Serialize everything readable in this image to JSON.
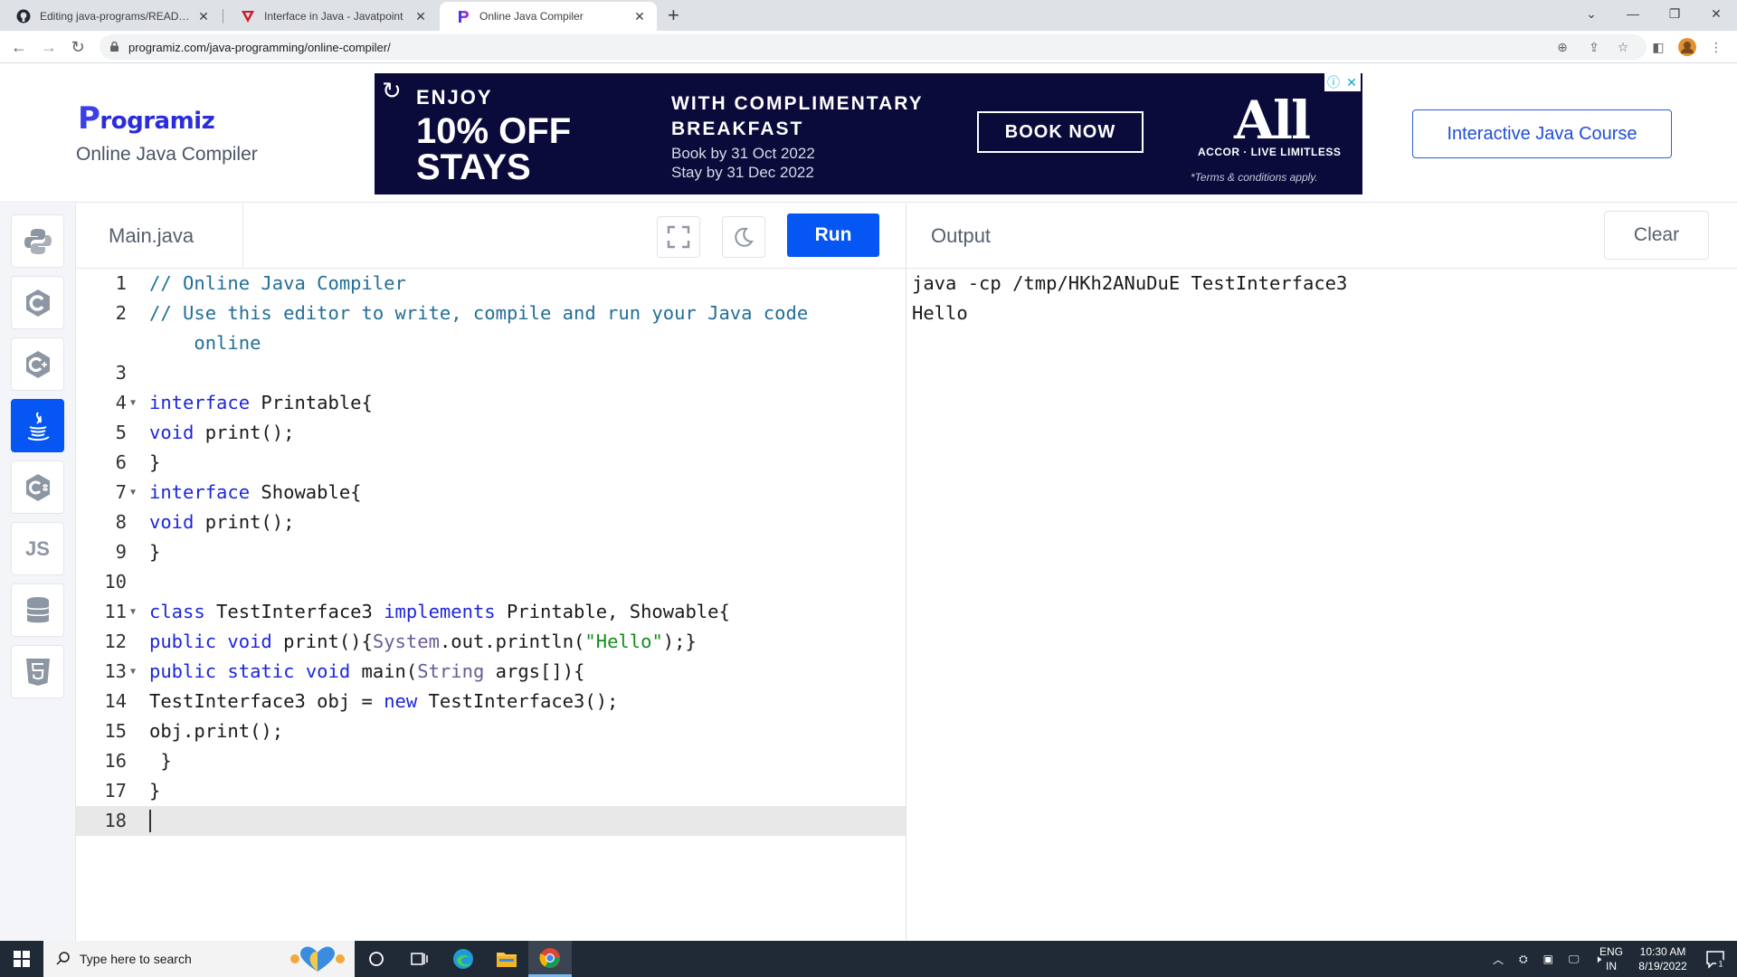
{
  "browser": {
    "tabs": [
      {
        "title": "Editing java-programs/README.md",
        "icon": "github-icon"
      },
      {
        "title": "Interface in Java - Javatpoint",
        "icon": "javatpoint-icon"
      },
      {
        "title": "Online Java Compiler",
        "icon": "programiz-icon"
      }
    ],
    "url": "programiz.com/java-programming/online-compiler/"
  },
  "header": {
    "logo": "rogramiz",
    "logo_initial": "P",
    "subtitle": "Online Java Compiler",
    "course_button": "Interactive Java Course"
  },
  "ad": {
    "enjoy": "ENJOY",
    "discount": "10% OFF",
    "stays": "STAYS",
    "complimentary_line1": "WITH COMPLIMENTARY",
    "complimentary_line2": "BREAKFAST",
    "book_by": "Book by 31 Oct 2022",
    "stay_by": "Stay by 31 Dec 2022",
    "book_now": "BOOK NOW",
    "brand": "All",
    "tagline": "ACCOR · LIVE LIMITLESS",
    "terms": "*Terms & conditions apply."
  },
  "sidebar": {
    "languages": [
      {
        "name": "python-icon",
        "label": ""
      },
      {
        "name": "c-icon",
        "label": ""
      },
      {
        "name": "cpp-icon",
        "label": ""
      },
      {
        "name": "java-icon",
        "label": "",
        "active": true
      },
      {
        "name": "csharp-icon",
        "label": ""
      },
      {
        "name": "javascript-icon",
        "label": "JS"
      },
      {
        "name": "sql-icon",
        "label": ""
      },
      {
        "name": "html5-icon",
        "label": ""
      }
    ]
  },
  "editor": {
    "filename": "Main.java",
    "run_label": "Run",
    "lines": [
      "1",
      "2",
      "",
      "3",
      "4",
      "5",
      "6",
      "7",
      "8",
      "9",
      "10",
      "11",
      "12",
      "13",
      "14",
      "15",
      "16",
      "17",
      "18"
    ]
  },
  "output": {
    "title": "Output",
    "clear_label": "Clear",
    "lines": [
      "java -cp /tmp/HKh2ANuDuE TestInterface3",
      "Hello"
    ]
  },
  "taskbar": {
    "search_placeholder": "Type here to search",
    "language": "ENG",
    "region": "IN",
    "time": "10:30 AM",
    "date": "8/19/2022",
    "notifications": "1"
  },
  "colors": {
    "accent": "#0556f3",
    "ad_background": "#0a0b3b",
    "comment": "#236e96",
    "keyword": "#1d26d9",
    "string": "#188b1f"
  }
}
